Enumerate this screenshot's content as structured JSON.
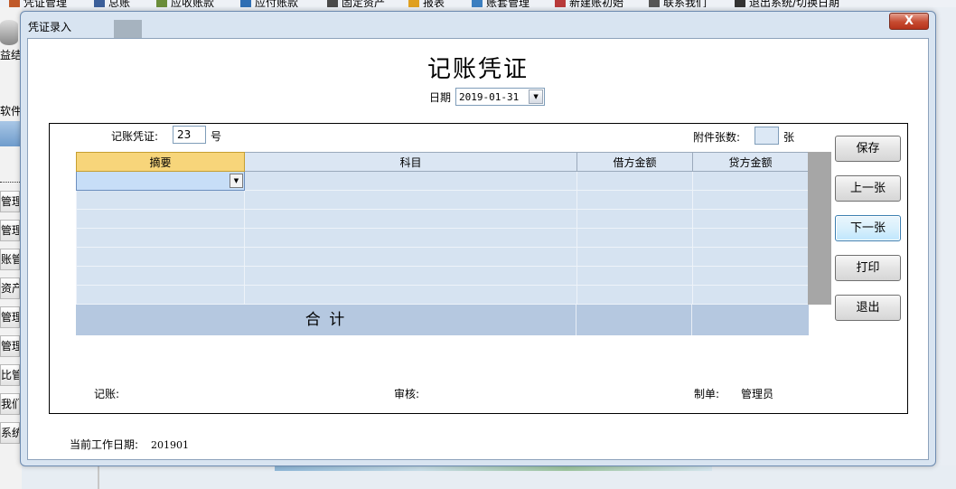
{
  "app": {
    "menu": [
      {
        "label": "凭证管理",
        "color": "#c05a2a"
      },
      {
        "label": "总账",
        "color": "#3b5f9a"
      },
      {
        "label": "应收账款",
        "color": "#6a8d3a"
      },
      {
        "label": "应付账款",
        "color": "#2f6fb4"
      },
      {
        "label": "固定资产",
        "color": "#4a4a4a"
      },
      {
        "label": "报表",
        "color": "#e0a020"
      },
      {
        "label": "账套管理",
        "color": "#3c7fc0"
      },
      {
        "label": "新建账初始",
        "color": "#b83a3a"
      },
      {
        "label": "联系我们",
        "color": "#555555"
      },
      {
        "label": "退出系统/切换日期",
        "color": "#333333"
      }
    ],
    "left_labels": [
      "益结转",
      "软件"
    ],
    "left_nav": [
      "管理",
      "管理",
      "账管理",
      "资产管理",
      "管理",
      "管理",
      "比管理",
      "我们",
      "系统"
    ]
  },
  "dialog": {
    "title": "凭证录入",
    "close_label": "X",
    "doc_title": "记账凭证",
    "date_label": "日期",
    "date_value": "2019-01-31",
    "voucher_label": "记账凭证:",
    "voucher_no": "23",
    "voucher_suffix": "号",
    "attach_label": "附件张数:",
    "attach_value": "",
    "attach_suffix": "张",
    "columns": [
      "摘要",
      "科目",
      "借方金额",
      "贷方金额"
    ],
    "rows": [
      [
        "",
        "",
        "",
        ""
      ],
      [
        "",
        "",
        "",
        ""
      ],
      [
        "",
        "",
        "",
        ""
      ],
      [
        "",
        "",
        "",
        ""
      ],
      [
        "",
        "",
        "",
        ""
      ],
      [
        "",
        "",
        "",
        ""
      ],
      [
        "",
        "",
        "",
        ""
      ]
    ],
    "total_label": "合  计",
    "total_debit": "",
    "total_credit": "",
    "buttons": {
      "save": "保存",
      "prev": "上一张",
      "next": "下一张",
      "print": "打印",
      "exit": "退出"
    },
    "signatures": {
      "bookkeeper_label": "记账:",
      "bookkeeper_value": "",
      "reviewer_label": "审核:",
      "reviewer_value": "",
      "maker_label": "制单:",
      "maker_value": "管理员"
    },
    "status_label": "当前工作日期:",
    "status_value": "201901"
  },
  "colors": {
    "header_active": "#f7d57a",
    "grid_cell": "#d6e3f1",
    "total_bg": "#b5c8e0",
    "close_button": "#c64a30"
  }
}
